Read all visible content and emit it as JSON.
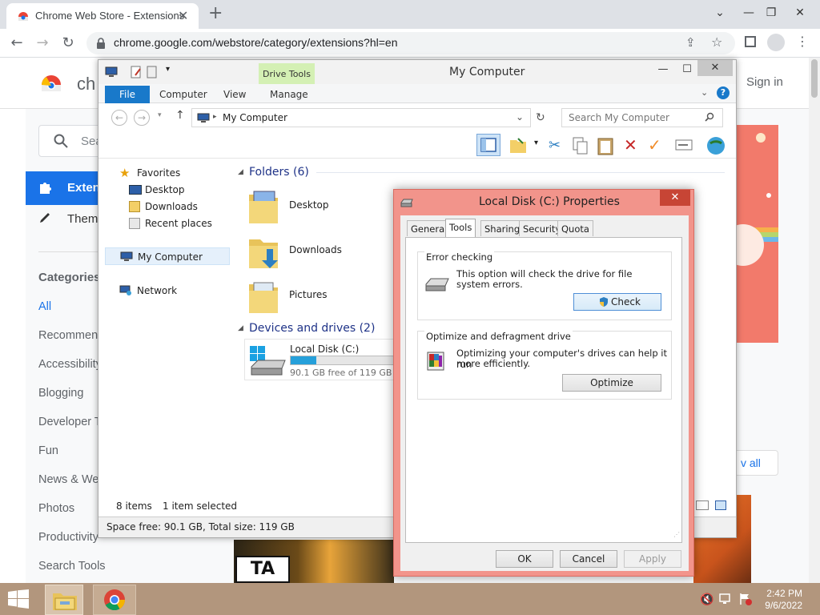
{
  "chrome": {
    "tab_title": "Chrome Web Store - Extensions",
    "url": "chrome.google.com/webstore/category/extensions?hl=en"
  },
  "store": {
    "brand_fragment": "ch",
    "sign_in": "Sign in",
    "search_placeholder": "Sea",
    "nav_extensions": "Exten",
    "nav_themes": "Them",
    "categories_title": "Categories",
    "categories": [
      "All",
      "Recommen",
      "Accessibility",
      "Blogging",
      "Developer T",
      "Fun",
      "News & We",
      "Photos",
      "Productivity",
      "Search Tools"
    ],
    "view_all": "v all",
    "card_badge": "TA"
  },
  "explorer": {
    "title": "My Computer",
    "drive_tools": "Drive Tools",
    "ribbon_tabs": [
      "File",
      "Computer",
      "View",
      "Manage"
    ],
    "address": "My Computer",
    "search_placeholder": "Search My Computer",
    "nav": {
      "favorites": "Favorites",
      "favorites_items": [
        "Desktop",
        "Downloads",
        "Recent places"
      ],
      "my_computer": "My Computer",
      "network": "Network"
    },
    "folders_group": "Folders (6)",
    "folders": [
      "Desktop",
      "Downloads",
      "Pictures"
    ],
    "devices_group": "Devices and drives (2)",
    "drive": {
      "name": "Local Disk (C:)",
      "free_text": "90.1 GB free of 119 GB",
      "used_fraction": 0.243
    },
    "status_items": "8 items",
    "status_selected": "1 item selected",
    "status_space": "Space free: 90.1 GB, Total size: 119 GB"
  },
  "properties": {
    "title": "Local Disk (C:) Properties",
    "tabs": [
      "General",
      "Tools",
      "Sharing",
      "Security",
      "Quota"
    ],
    "active_tab": "Tools",
    "error_group": "Error checking",
    "error_text_1": "This option will check the drive for file",
    "error_text_2": "system errors.",
    "check_button": "Check",
    "optimize_group": "Optimize and defragment drive",
    "optimize_text_1": "Optimizing your computer's drives can help it run",
    "optimize_text_2": "more efficiently.",
    "optimize_button": "Optimize",
    "ok": "OK",
    "cancel": "Cancel",
    "apply": "Apply"
  },
  "taskbar": {
    "time": "2:42 PM",
    "date": "9/6/2022"
  },
  "colors": {
    "file_tab": "#1979ca",
    "dialog_frame": "#f2948b",
    "taskbar": "#b2967d",
    "drive_bar": "#26a0da"
  }
}
